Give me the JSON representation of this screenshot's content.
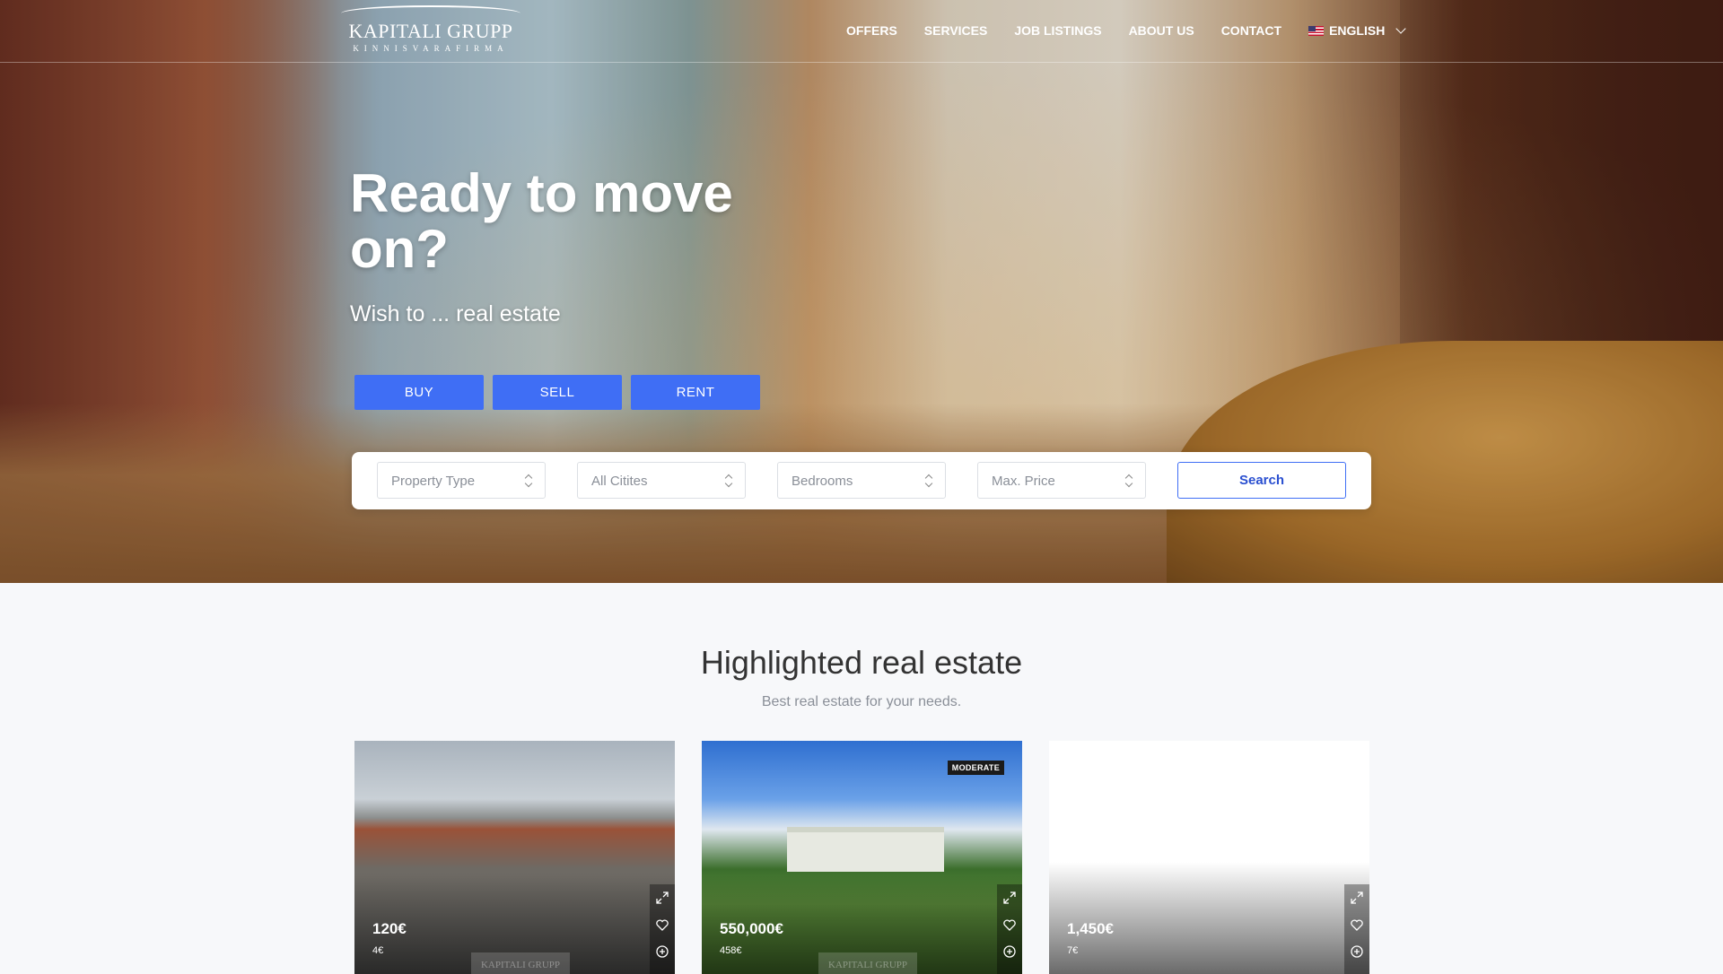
{
  "nav": {
    "logo_name": "KAPITALI GRUPP",
    "logo_sub": "KINNISVARAFIRMA",
    "items": [
      "OFFERS",
      "SERVICES",
      "JOB LISTINGS",
      "ABOUT US",
      "CONTACT"
    ],
    "language": "ENGLISH"
  },
  "hero": {
    "headline": "Ready to move on?",
    "subline": "Wish to ... real estate",
    "tabs": [
      "BUY",
      "SELL",
      "RENT"
    ]
  },
  "search": {
    "property_type": "Property Type",
    "cities": "All Citites",
    "bedrooms": "Bedrooms",
    "max_price": "Max. Price",
    "button": "Search"
  },
  "section": {
    "title": "Highlighted real estate",
    "subtitle": "Best real estate for your needs."
  },
  "listings": [
    {
      "price": "120€",
      "price_per_m2": "4€",
      "badge": ""
    },
    {
      "price": "550,000€",
      "price_per_m2": "458€",
      "badge": "MODERATE"
    },
    {
      "price": "1,450€",
      "price_per_m2": "7€",
      "badge": ""
    }
  ],
  "watermark": "KAPITALI GRUPP",
  "colors": {
    "accent": "#3f6ef5",
    "background": "#f7f8fa"
  }
}
